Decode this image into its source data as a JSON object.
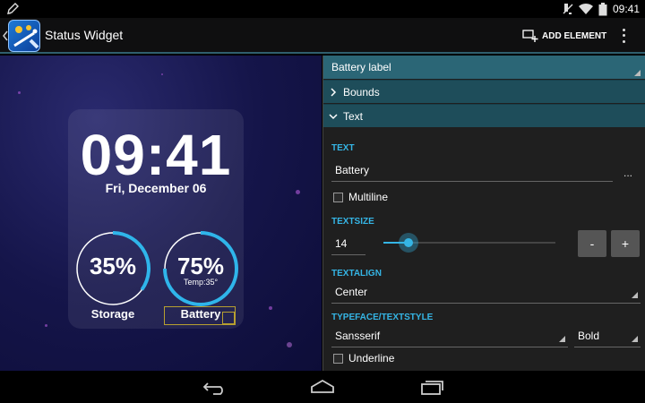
{
  "status_bar": {
    "time": "09:41"
  },
  "action_bar": {
    "title": "Status Widget",
    "add_element_label": "ADD ELEMENT"
  },
  "widget": {
    "time": "09:41",
    "date": "Fri, December 06",
    "storage": {
      "percent_text": "35%",
      "percent": 0.35,
      "label": "Storage"
    },
    "battery": {
      "percent_text": "75%",
      "percent": 0.75,
      "temp": "Temp:35°",
      "label": "Battery"
    },
    "accent_color": "#2fb5ea"
  },
  "panel": {
    "element_select": "Battery label",
    "sections": {
      "bounds": "Bounds",
      "text": "Text"
    },
    "text_label": "TEXT",
    "text_value": "Battery",
    "text_more": "...",
    "multiline_label": "Multiline",
    "textsize_label": "TEXTSIZE",
    "textsize_value": "14",
    "minus_label": "-",
    "plus_label": "+",
    "textalign_label": "TEXTALIGN",
    "textalign_value": "Center",
    "typeface_label": "TYPEFACE/TEXTSTYLE",
    "typeface_value": "Sansserif",
    "textstyle_value": "Bold",
    "underline_label": "Underline"
  },
  "colors": {
    "accent": "#35b5e5",
    "section_bg": "#1e4d5a",
    "header_bg": "#2b6676"
  }
}
